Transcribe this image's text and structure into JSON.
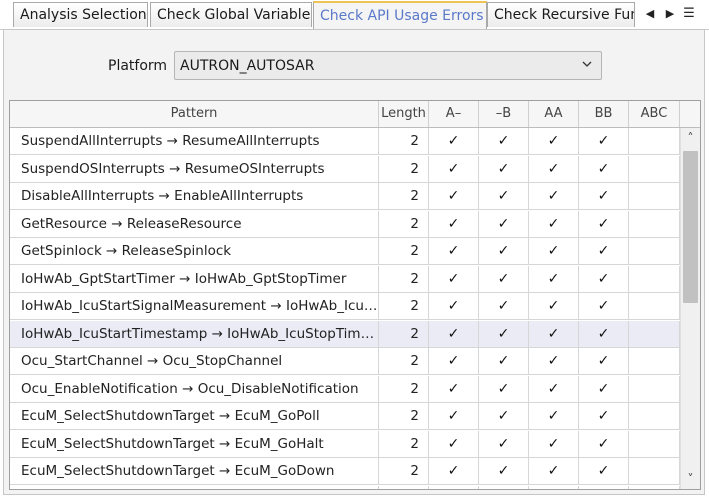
{
  "tabs": [
    {
      "label": "Analysis Selection",
      "active": false
    },
    {
      "label": "Check Global Variables",
      "active": false
    },
    {
      "label": "Check API Usage Errors",
      "active": true
    },
    {
      "label": "Check Recursive Functions",
      "active": false
    }
  ],
  "tab_controls": {
    "prev": "◀",
    "next": "▶",
    "list": "☰"
  },
  "platform": {
    "label": "Platform",
    "value": "AUTRON_AUTOSAR"
  },
  "table": {
    "headers": [
      "Pattern",
      "Length",
      "A–",
      "–B",
      "AA",
      "BB",
      "ABC"
    ],
    "check_mark": "✓",
    "rows": [
      {
        "pattern": "SuspendAllInterrupts → ResumeAllInterrupts",
        "length": "2",
        "checks": [
          true,
          true,
          true,
          true,
          false
        ]
      },
      {
        "pattern": "SuspendOSInterrupts → ResumeOSInterrupts",
        "length": "2",
        "checks": [
          true,
          true,
          true,
          true,
          false
        ]
      },
      {
        "pattern": "DisableAllInterrupts → EnableAllInterrupts",
        "length": "2",
        "checks": [
          true,
          true,
          true,
          true,
          false
        ]
      },
      {
        "pattern": "GetResource → ReleaseResource",
        "length": "2",
        "checks": [
          true,
          true,
          true,
          true,
          false
        ]
      },
      {
        "pattern": "GetSpinlock → ReleaseSpinlock",
        "length": "2",
        "checks": [
          true,
          true,
          true,
          true,
          false
        ]
      },
      {
        "pattern": "IoHwAb_GptStartTimer → IoHwAb_GptStopTimer",
        "length": "2",
        "checks": [
          true,
          true,
          true,
          true,
          false
        ]
      },
      {
        "pattern": "IoHwAb_IcuStartSignalMeasurement → IoHwAb_IcuSt...",
        "length": "2",
        "checks": [
          true,
          true,
          true,
          true,
          false
        ]
      },
      {
        "pattern": "IoHwAb_IcuStartTimestamp → IoHwAb_IcuStopTimes...",
        "length": "2",
        "checks": [
          true,
          true,
          true,
          true,
          false
        ],
        "selected": true
      },
      {
        "pattern": "Ocu_StartChannel → Ocu_StopChannel",
        "length": "2",
        "checks": [
          true,
          true,
          true,
          true,
          false
        ]
      },
      {
        "pattern": "Ocu_EnableNotification → Ocu_DisableNotification",
        "length": "2",
        "checks": [
          true,
          true,
          true,
          true,
          false
        ]
      },
      {
        "pattern": "EcuM_SelectShutdownTarget → EcuM_GoPoll",
        "length": "2",
        "checks": [
          true,
          true,
          true,
          true,
          false
        ]
      },
      {
        "pattern": "EcuM_SelectShutdownTarget → EcuM_GoHalt",
        "length": "2",
        "checks": [
          true,
          true,
          true,
          true,
          false
        ]
      },
      {
        "pattern": "EcuM_SelectShutdownTarget → EcuM_GoDown",
        "length": "2",
        "checks": [
          true,
          true,
          true,
          true,
          false
        ]
      },
      {
        "pattern": "",
        "length": "",
        "checks": [
          false,
          false,
          false,
          false,
          false
        ]
      }
    ]
  },
  "scrollbar": {
    "up": "˄",
    "down": "˅",
    "position_fraction": 0.0
  }
}
